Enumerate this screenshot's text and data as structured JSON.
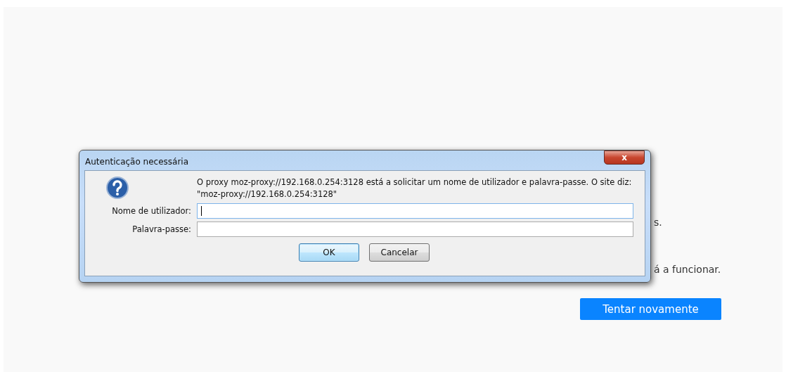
{
  "page": {
    "texts": [
      "s.",
      "á a funcionar."
    ],
    "retry_button": "Tentar novamente"
  },
  "dialog": {
    "title": "Autenticação necessária",
    "close_button": "x",
    "message": "O proxy moz-proxy://192.168.0.254:3128 está a solicitar um nome de utilizador e palavra-passe. O site diz: \"moz-proxy://192.168.0.254:3128\"",
    "fields": [
      {
        "label": "Nome de utilizador:",
        "focused": true
      },
      {
        "label": "Palavra-passe:",
        "focused": false
      }
    ],
    "buttons": [
      {
        "label": "OK",
        "default": true
      },
      {
        "label": "Cancelar",
        "default": false
      }
    ]
  }
}
